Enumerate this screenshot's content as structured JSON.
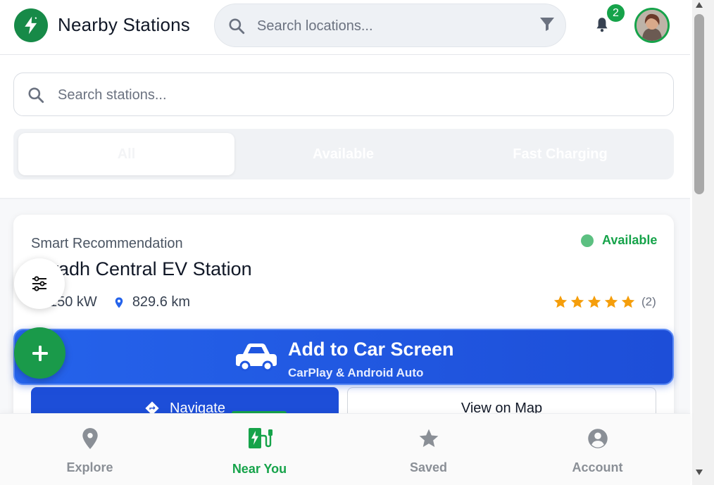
{
  "header": {
    "title": "Nearby Stations",
    "search_placeholder": "Search locations...",
    "notification_count": "2"
  },
  "station_search": {
    "placeholder": "Search stations..."
  },
  "filters": {
    "tabs": [
      {
        "label": "All",
        "active": true
      },
      {
        "label": "Available",
        "active": false
      },
      {
        "label": "Fast Charging",
        "active": false
      }
    ]
  },
  "card": {
    "tag": "Smart Recommendation",
    "status": "Available",
    "status_color": "#16a34a",
    "name": "Riyadh Central EV Station",
    "power": "150 kW",
    "distance": "829.6 km",
    "rating": 5,
    "rating_count": "(2)",
    "navigate_label": "Navigate",
    "map_label": "View on Map"
  },
  "car_banner": {
    "title": "Add to Car Screen",
    "subtitle": "CarPlay & Android Auto"
  },
  "bottom_nav": [
    {
      "label": "Explore",
      "icon": "map-pin-icon",
      "active": false
    },
    {
      "label": "Near You",
      "icon": "ev-charger-icon",
      "active": true
    },
    {
      "label": "Saved",
      "icon": "star-icon",
      "active": false
    },
    {
      "label": "Account",
      "icon": "user-circle-icon",
      "active": false
    }
  ],
  "colors": {
    "brand_green": "#16a34a",
    "primary_blue": "#1d4ed8",
    "star": "#f59e0b"
  }
}
